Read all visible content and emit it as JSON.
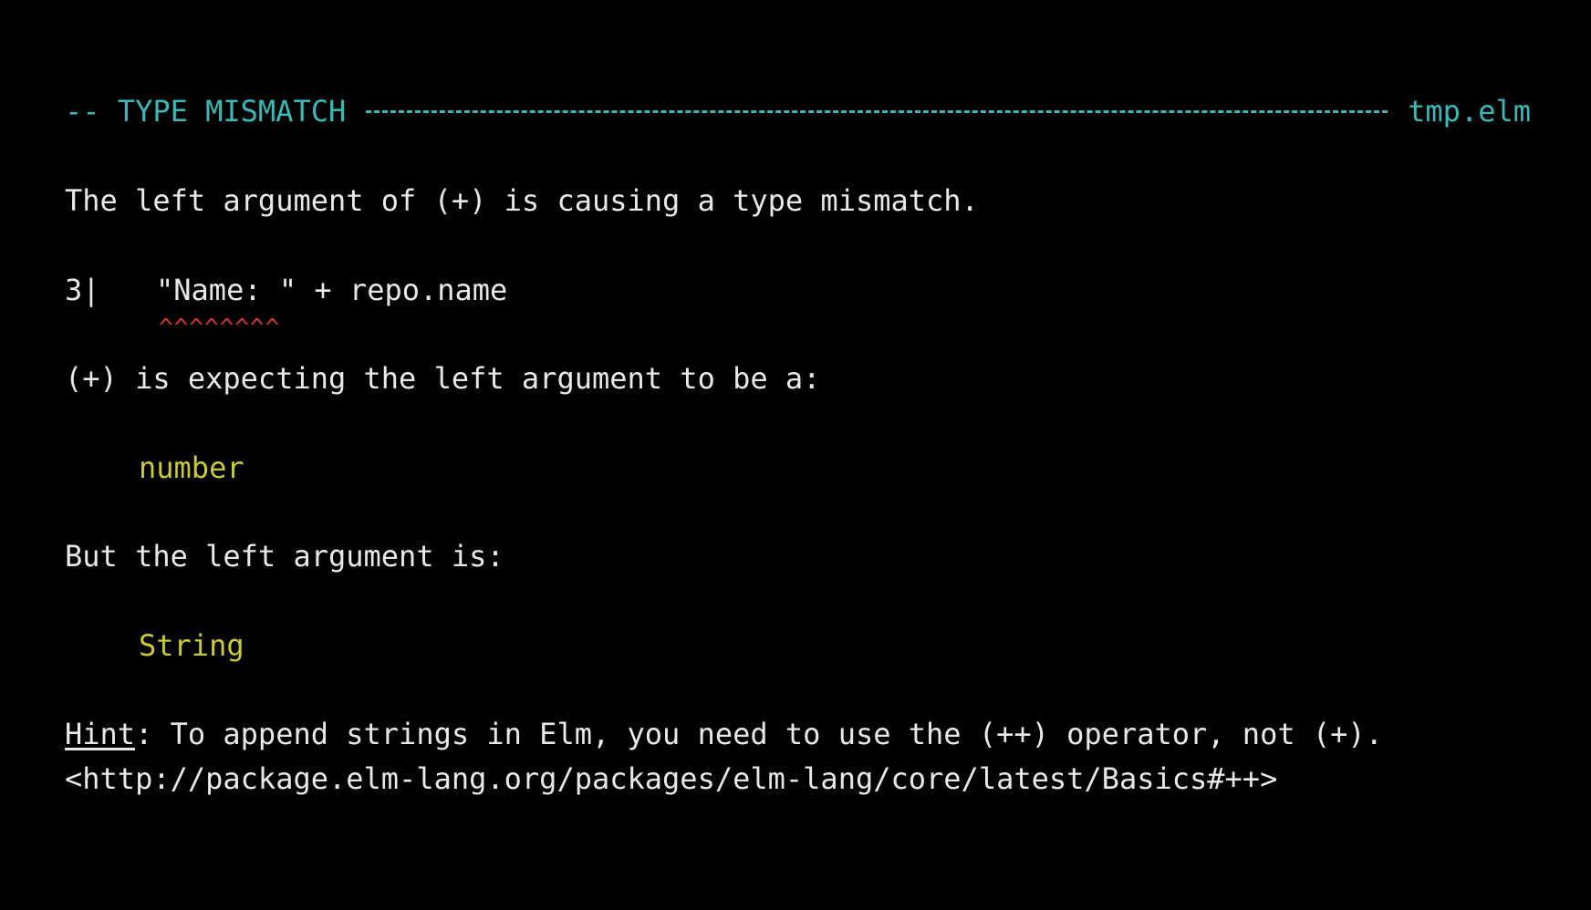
{
  "header": {
    "title": "-- TYPE MISMATCH",
    "file": "tmp.elm"
  },
  "message": {
    "intro": "The left argument of (+) is causing a type mismatch.",
    "code_line_number": "3|",
    "code_text": "\"Name: \" + repo.name",
    "carets": "^^^^^^^^",
    "expecting": "(+) is expecting the left argument to be a:",
    "expected_type": "number",
    "actual_intro": "But the left argument is:",
    "actual_type": "String",
    "hint_label": "Hint",
    "hint_text": ": To append strings in Elm, you need to use the (++) operator, not (+).",
    "hint_link": "<http://package.elm-lang.org/packages/elm-lang/core/latest/Basics#++>"
  },
  "colors": {
    "background": "#000000",
    "header": "#3fb6b6",
    "error_marker": "#d23a30",
    "type": "#c9c93a",
    "text": "#e8e8e8"
  }
}
